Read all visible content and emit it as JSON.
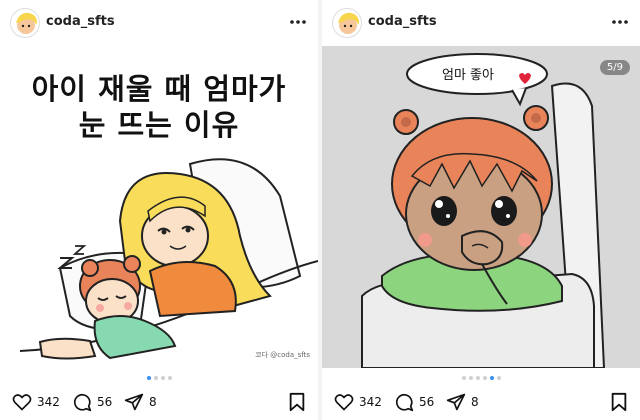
{
  "posts": [
    {
      "username": "coda_sfts",
      "headline_line1": "아이 재울 때 엄마가",
      "headline_line2": "눈 뜨는 이유",
      "signature": "코다 @coda_sfts",
      "likes": "342",
      "comments": "56",
      "shares": "8",
      "dots": {
        "count": 4,
        "active_index": 0
      }
    },
    {
      "username": "coda_sfts",
      "page_counter": "5/9",
      "speech_bubble": "엄마 좋아",
      "likes": "342",
      "comments": "56",
      "shares": "8",
      "dots": {
        "count": 6,
        "active_index": 4
      }
    }
  ],
  "colors": {
    "accent_dot": "#3a8ff2",
    "heart": "#e0243a"
  }
}
